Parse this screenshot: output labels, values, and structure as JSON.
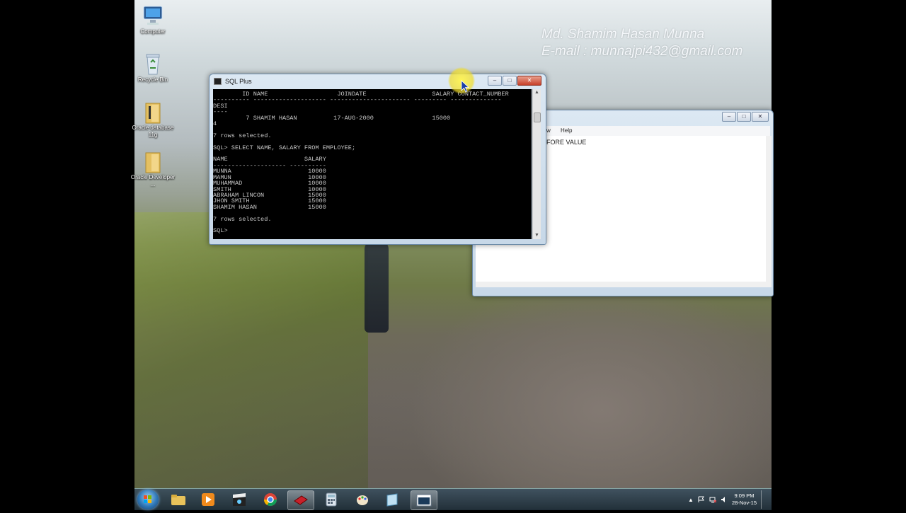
{
  "watermark": {
    "name": "Md. Shamim Hasan Munna",
    "email": "E-mail : munnajpi432@gmail.com"
  },
  "desktop_icons": [
    {
      "label": "Computer",
      "icon": "computer-icon"
    },
    {
      "label": "Recycle Bin",
      "icon": "recycle-bin-icon"
    },
    {
      "label": "Oracle database 11g",
      "icon": "folder-icon"
    },
    {
      "label": "Oracle Developer ...",
      "icon": "folder-icon"
    }
  ],
  "sqlplus": {
    "title": "SQL Plus",
    "controls": {
      "minimize": "‒",
      "maximize": "□",
      "close": "✕"
    },
    "console": [
      "        ID NAME                   JOINDATE                  SALARY CONTACT_NUMBER",
      "---------- -------------------- ---------------------- --------- --------------",
      "DESI",
      "----",
      "         7 SHAMIM HASAN          17-AUG-2000                15000",
      "4",
      "",
      "7 rows selected.",
      "",
      "SQL> SELECT NAME, SALARY FROM EMPLOYEE;",
      "",
      "NAME                     SALARY",
      "-------------------- ----------",
      "MUNNA                     10000",
      "MAMUN                     10000",
      "MUHAMMAD                  10000",
      "SMITH                     10000",
      "ABRAHAM LINCON            15000",
      "JHON SMITH                15000",
      "SHAMIM HASAN              15000",
      "",
      "7 rows selected.",
      "",
      "SQL> "
    ]
  },
  "notepad": {
    "menu_help": "Help",
    "menu_partial": "w",
    "text": "FORE VALUE",
    "controls": {
      "minimize": "‒",
      "maximize": "□",
      "close": "✕"
    }
  },
  "taskbar": {
    "items": [
      {
        "name": "explorer",
        "icon": "folder-icon"
      },
      {
        "name": "media-player",
        "icon": "media-player-icon"
      },
      {
        "name": "media-center",
        "icon": "clapper-icon"
      },
      {
        "name": "chrome",
        "icon": "chrome-icon"
      },
      {
        "name": "oracle-app",
        "icon": "book-icon"
      },
      {
        "name": "calculator",
        "icon": "calculator-icon"
      },
      {
        "name": "paint",
        "icon": "paint-icon"
      },
      {
        "name": "notepad",
        "icon": "notepad-icon"
      },
      {
        "name": "sqlplus",
        "icon": "console-icon"
      }
    ],
    "tray_arrow": "▲",
    "time": "9:09 PM",
    "date": "28-Nov-15"
  }
}
